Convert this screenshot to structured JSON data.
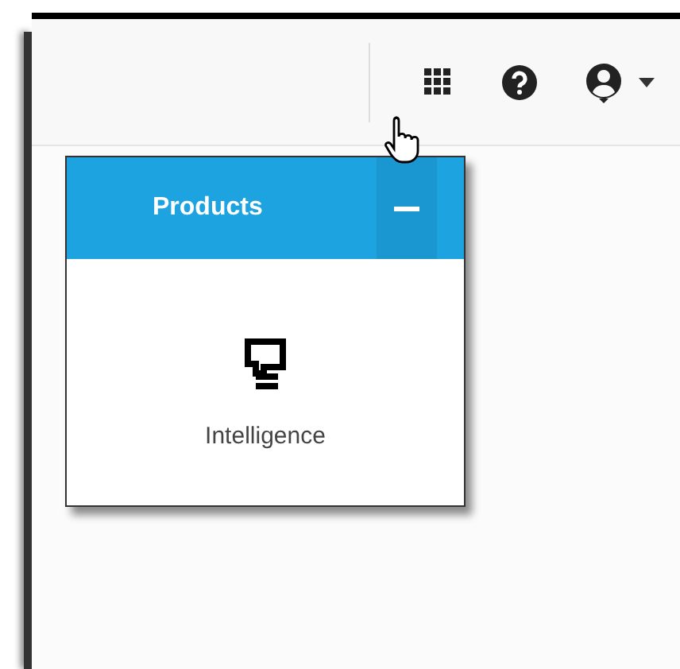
{
  "products_panel": {
    "title": "Products",
    "expanded": true,
    "items": [
      {
        "label": "Intelligence"
      }
    ]
  }
}
